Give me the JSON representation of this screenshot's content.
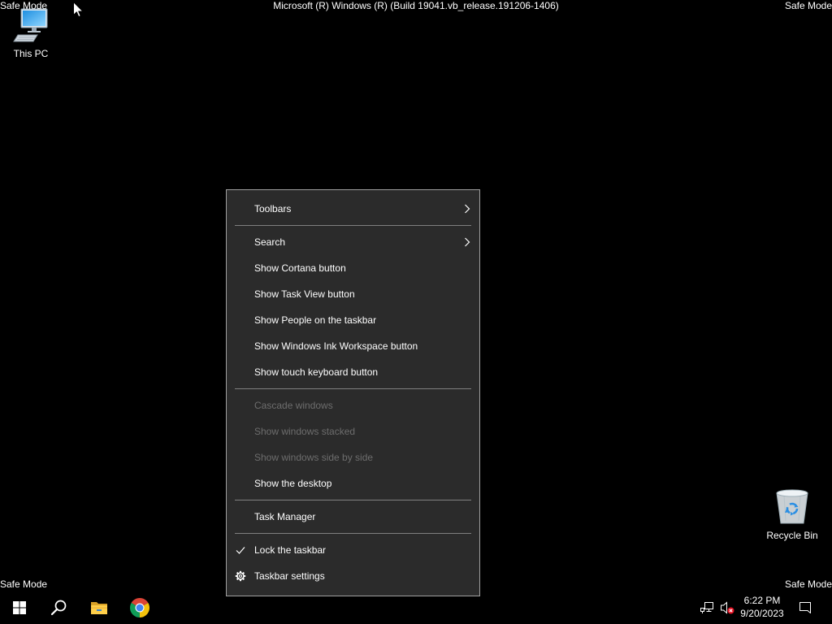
{
  "watermark": {
    "top_left": "Safe Mode",
    "top_right": "Safe Mode",
    "bottom_left": "Safe Mode",
    "bottom_right": "Safe Mode",
    "build": "Microsoft (R) Windows (R) (Build 19041.vb_release.191206-1406)"
  },
  "desktop": {
    "this_pc": {
      "label": "This PC",
      "icon": "computer-icon"
    },
    "recycle_bin": {
      "label": "Recycle Bin",
      "icon": "recycle-bin-icon"
    }
  },
  "context_menu": {
    "items": [
      {
        "label": "Toolbars",
        "enabled": true,
        "submenu": true
      },
      {
        "label": "Search",
        "enabled": true,
        "submenu": true
      },
      {
        "label": "Show Cortana button",
        "enabled": true
      },
      {
        "label": "Show Task View button",
        "enabled": true
      },
      {
        "label": "Show People on the taskbar",
        "enabled": true
      },
      {
        "label": "Show Windows Ink Workspace button",
        "enabled": true
      },
      {
        "label": "Show touch keyboard button",
        "enabled": true
      },
      {
        "label": "Cascade windows",
        "enabled": false
      },
      {
        "label": "Show windows stacked",
        "enabled": false
      },
      {
        "label": "Show windows side by side",
        "enabled": false
      },
      {
        "label": "Show the desktop",
        "enabled": true
      },
      {
        "label": "Task Manager",
        "enabled": true
      },
      {
        "label": "Lock the taskbar",
        "enabled": true,
        "checked": true
      },
      {
        "label": "Taskbar settings",
        "enabled": true,
        "icon": "gear-icon"
      }
    ]
  },
  "taskbar": {
    "pinned": [
      {
        "icon": "windows-start-icon"
      },
      {
        "icon": "search-icon"
      },
      {
        "icon": "file-explorer-icon"
      },
      {
        "icon": "chrome-icon"
      }
    ],
    "tray": {
      "network_icon": "wired-network-icon",
      "volume_icon": "volume-muted-icon",
      "time": "6:22 PM",
      "date": "9/20/2023",
      "notification_icon": "notification-icon"
    }
  },
  "colors": {
    "desktop_background": "#000000",
    "taskbar_background": "#000000",
    "menu_background": "#2b2b2b",
    "menu_border": "#a0a0a0",
    "menu_text": "#ffffff",
    "menu_text_disabled": "#6d6d6d",
    "menu_separator": "#808080"
  }
}
